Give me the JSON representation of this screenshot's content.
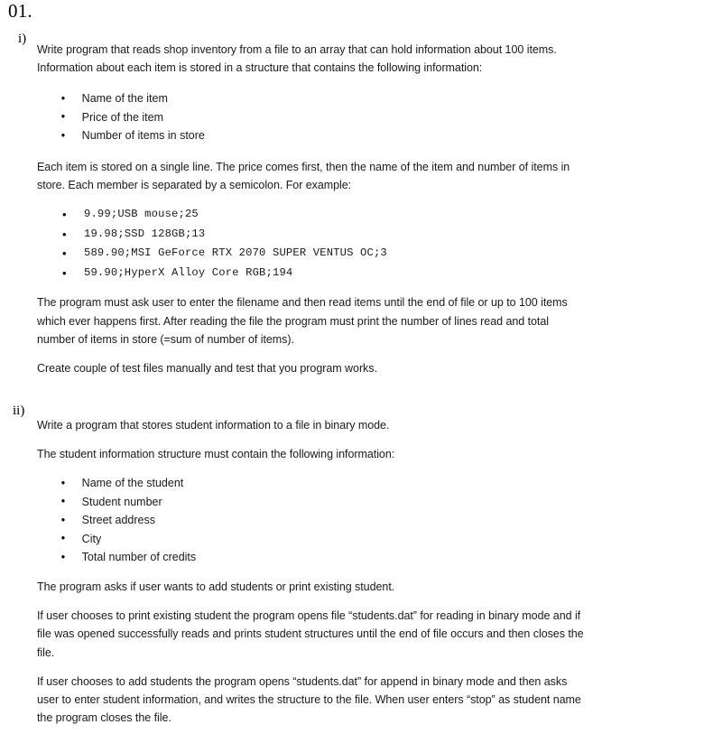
{
  "document": {
    "number_label": "01.",
    "sections": [
      {
        "marker": "i)",
        "intro": "Write program that reads shop inventory from a file to an array that can hold information about 100 items. Information about each item is stored in a structure that contains the following information:",
        "fields": [
          "Name of the item",
          "Price of the item",
          "Number of items in store"
        ],
        "format_note": "Each item is stored on a single line. The price comes first, then the name of the item and number of items in store. Each member is separated by a semicolon. For example:",
        "examples": [
          "9.99;USB mouse;25",
          "19.98;SSD 128GB;13",
          "589.90;MSI GeForce RTX 2070 SUPER VENTUS OC;3",
          "59.90;HyperX Alloy Core RGB;194"
        ],
        "requirements": "The program must ask user to enter the filename and then read items until the end of file or up to 100 items which ever happens first. After reading the file the program must print the number of lines read and total number of items in store (=sum of number of items).",
        "closing": "Create couple of test files manually and test that you program works."
      },
      {
        "marker": "ii)",
        "intro": "Write a program that stores student information to a file in binary mode.",
        "structure_note": "The student information structure must contain the following information:",
        "fields": [
          "Name of the student",
          "Student number",
          "Street address",
          "City",
          "Total number of credits"
        ],
        "prompt_note": "The program asks if user wants to add students or print existing student.",
        "read_note": "If user chooses to print existing student the program opens file “students.dat” for reading in binary mode and if file was opened successfully reads and prints student structures until the end of file occurs and then closes the file.",
        "write_note": "If user chooses to add students the program opens “students.dat” for append in binary mode and then asks user to enter student information, and writes the structure to the file. When user enters “stop” as student name the program closes the file."
      }
    ]
  },
  "colors": {
    "page_background": "#ffffff",
    "body_text": "#1a1a1a",
    "heading_text": "#000000"
  }
}
